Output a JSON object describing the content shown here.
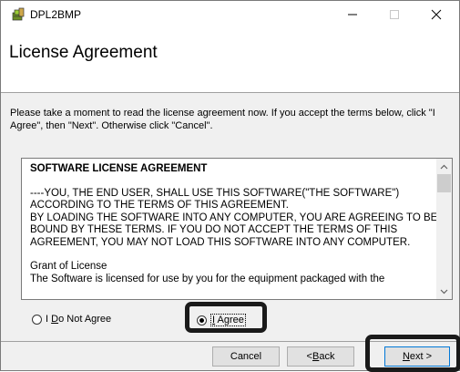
{
  "window": {
    "title": "DPL2BMP",
    "icon": "installer-app-icon"
  },
  "header": {
    "title": "License Agreement"
  },
  "instructions": "Please take a moment to read the license agreement now. If you accept the terms below, click \"I Agree\", then \"Next\". Otherwise click \"Cancel\".",
  "license": {
    "heading": "SOFTWARE LICENSE AGREEMENT",
    "lines": [
      "----YOU, THE END USER, SHALL USE THIS SOFTWARE(\"THE SOFTWARE\")",
      "ACCORDING TO THE TERMS OF THIS AGREEMENT.",
      "BY LOADING THE SOFTWARE INTO ANY COMPUTER, YOU ARE AGREEING TO BE",
      "BOUND BY THESE TERMS. IF YOU DO NOT ACCEPT THE TERMS OF THIS",
      "AGREEMENT, YOU MAY NOT LOAD THIS SOFTWARE INTO ANY COMPUTER."
    ],
    "grant_heading": "Grant of License",
    "grant_line": "The Software is licensed for use by you for the equipment packaged with the"
  },
  "radios": {
    "not_agree": {
      "prefix": "I ",
      "accel": "D",
      "rest": "o Not Agree",
      "checked": false
    },
    "agree": {
      "accel": "I",
      "rest": " Agree",
      "checked": true
    }
  },
  "buttons": {
    "cancel": "Cancel",
    "back_prefix": "< ",
    "back_accel": "B",
    "back_rest": "ack",
    "next_accel": "N",
    "next_rest": "ext >"
  }
}
